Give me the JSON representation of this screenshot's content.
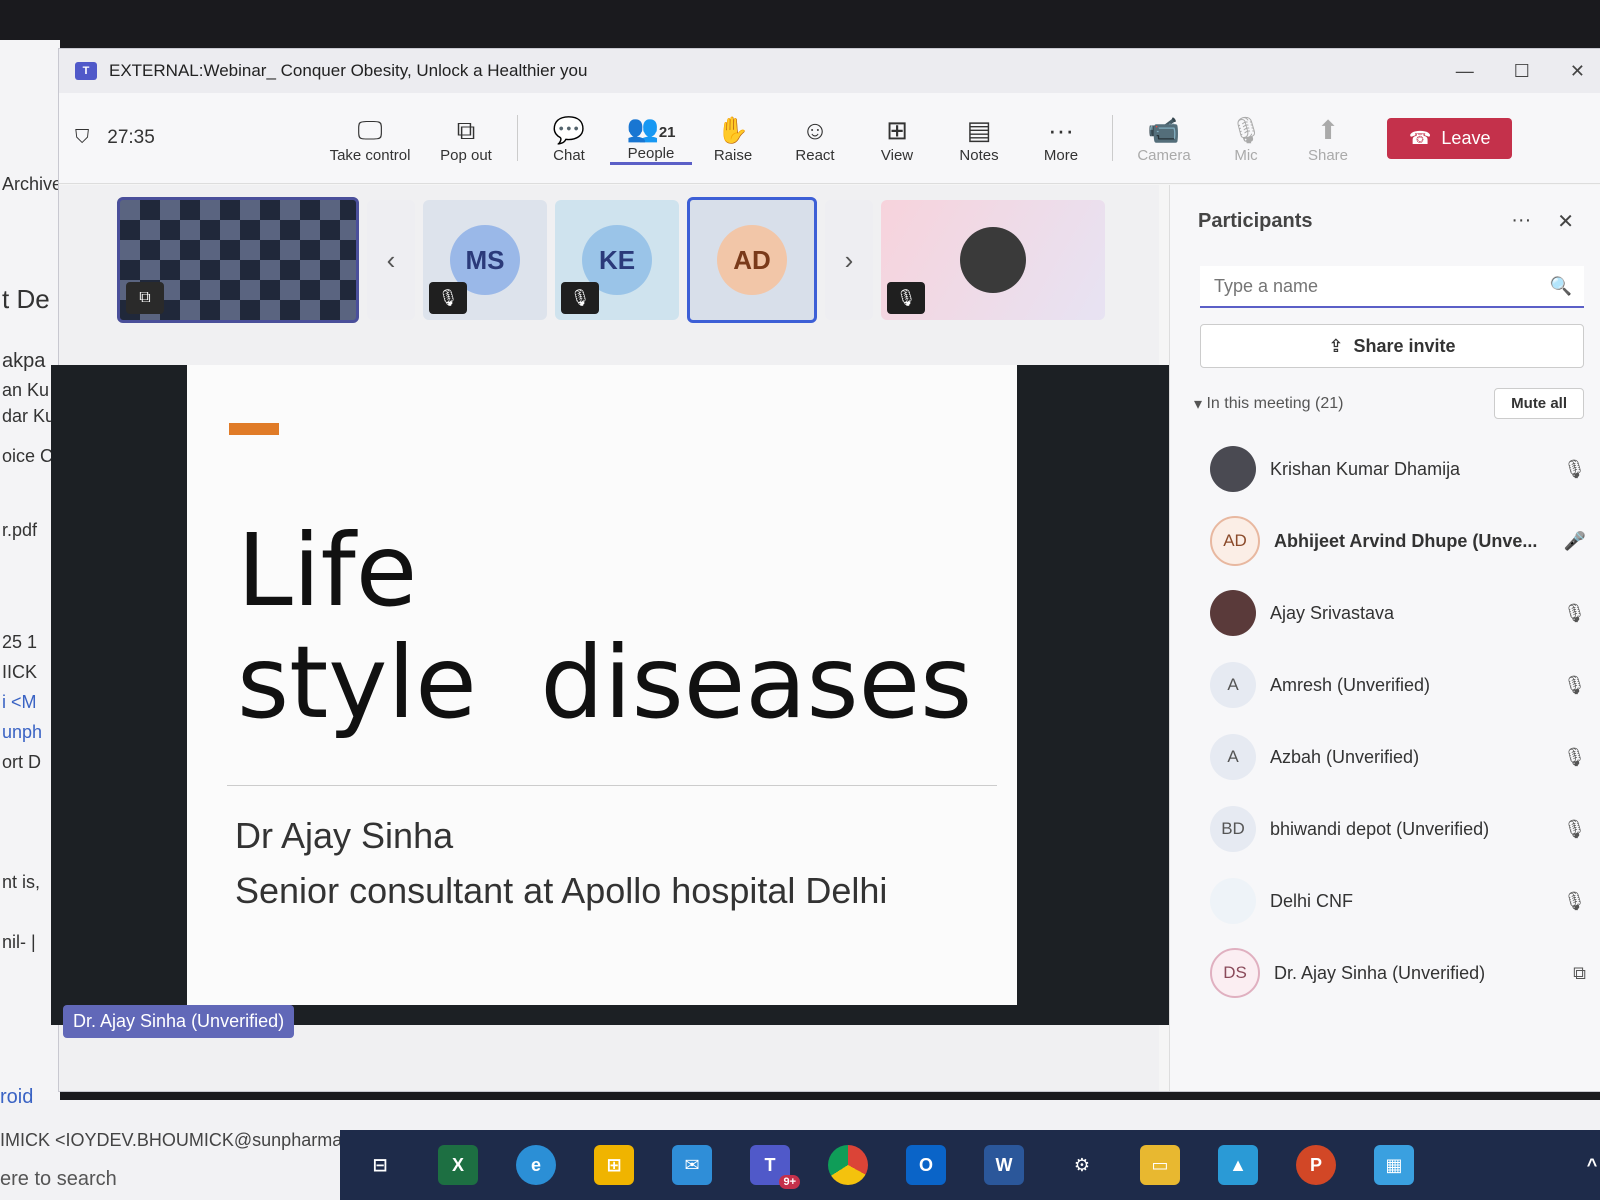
{
  "background": {
    "left_fragments": [
      "Archive",
      "t De",
      "akpa",
      "an Ku",
      "dar Ku",
      "oice C",
      "r.pdf",
      "25 1",
      "IICK",
      "i <M",
      "unph",
      "ort D",
      "nt is,",
      "nil- |"
    ],
    "bottom_link": "roid",
    "bottom_email": "IMICK <IOYDEV.BHOUMICK@sunpharma.com>",
    "bottom_search": "ere to search"
  },
  "window": {
    "title": "EXTERNAL:Webinar_ Conquer Obesity, Unlock a Healthier you"
  },
  "toolbar": {
    "timer": "27:35",
    "buttons": [
      {
        "label": "Take control",
        "icon": "🖵"
      },
      {
        "label": "Pop out",
        "icon": "⧉"
      },
      {
        "label": "Chat",
        "icon": "💬"
      },
      {
        "label": "People",
        "icon": "👥",
        "count": "21"
      },
      {
        "label": "Raise",
        "icon": "✋"
      },
      {
        "label": "React",
        "icon": "☺"
      },
      {
        "label": "View",
        "icon": "⊞"
      },
      {
        "label": "Notes",
        "icon": "▤"
      },
      {
        "label": "More",
        "icon": "···"
      },
      {
        "label": "Camera",
        "icon": "📹"
      },
      {
        "label": "Mic",
        "icon": "🎙"
      },
      {
        "label": "Share",
        "icon": "⬆"
      }
    ],
    "leave_label": "Leave"
  },
  "tiles": [
    {
      "initials": "MS",
      "color": "#9ab8e8"
    },
    {
      "initials": "KE",
      "color": "#9ac4e8"
    },
    {
      "initials": "AD",
      "color": "#f2c6a8"
    }
  ],
  "slide": {
    "title_line1": "Life",
    "title_line2": "style  diseases",
    "subtitle1": "Dr Ajay Sinha",
    "subtitle2": "Senior consultant at Apollo hospital Delhi"
  },
  "presenter_label": "Dr. Ajay Sinha (Unverified)",
  "participants": {
    "heading": "Participants",
    "search_placeholder": "Type a name",
    "share_invite": "Share invite",
    "in_meeting": "In this meeting (21)",
    "mute_all": "Mute all",
    "list": [
      {
        "initials": "",
        "name": "Krishan Kumar Dhamija",
        "photo": true,
        "mic": "muted"
      },
      {
        "initials": "AD",
        "name": "Abhijeet Arvind Dhupe (Unve...",
        "photo": false,
        "mic": "on"
      },
      {
        "initials": "",
        "name": "Ajay Srivastava",
        "photo": true,
        "mic": "muted"
      },
      {
        "initials": "A",
        "name": "Amresh (Unverified)",
        "photo": false,
        "mic": "muted"
      },
      {
        "initials": "A",
        "name": "Azbah (Unverified)",
        "photo": false,
        "mic": "muted"
      },
      {
        "initials": "BD",
        "name": "bhiwandi depot (Unverified)",
        "photo": false,
        "mic": "muted"
      },
      {
        "initials": "",
        "name": "Delhi CNF",
        "photo": false,
        "mic": "muted"
      },
      {
        "initials": "DS",
        "name": "Dr. Ajay Sinha (Unverified)",
        "photo": false,
        "mic": "sharing"
      }
    ]
  },
  "taskbar": {
    "teams_badge": "9+"
  }
}
